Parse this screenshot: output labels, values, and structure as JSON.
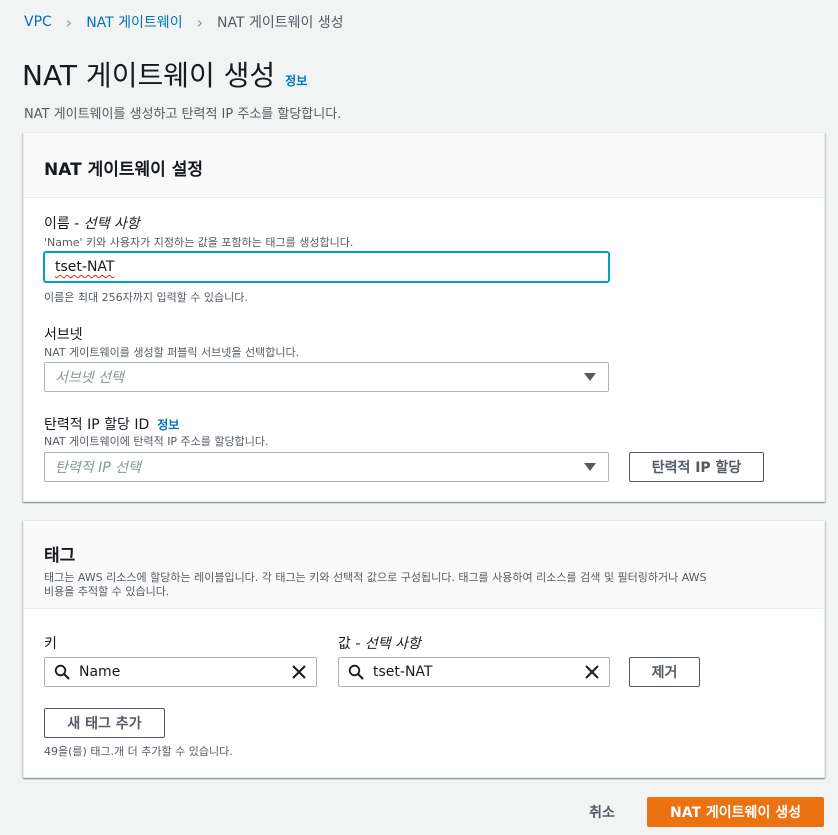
{
  "breadcrumb": {
    "items": [
      "VPC",
      "NAT 게이트웨이"
    ],
    "current": "NAT 게이트웨이 생성"
  },
  "page": {
    "title": "NAT 게이트웨이 생성",
    "info": "정보",
    "description": "NAT 게이트웨이를 생성하고 탄력적 IP 주소를 할당합니다."
  },
  "settings": {
    "title": "NAT 게이트웨이 설정",
    "name": {
      "label": "이름 - ",
      "label_optional": "선택 사항",
      "description": "'Name' 키와 사용자가 지정하는 값을 포함하는 태그를 생성합니다.",
      "value": "tset-NAT",
      "hint": "이름은 최대 256자까지 입력할 수 있습니다."
    },
    "subnet": {
      "label": "서브넷",
      "description": "NAT 게이트웨이를 생성할 퍼블릭 서브넷을 선택합니다.",
      "placeholder": "서브넷 선택"
    },
    "eip": {
      "label": "탄력적 IP 할당 ID",
      "info": "정보",
      "description": "NAT 게이트웨이에 탄력적 IP 주소를 할당합니다.",
      "placeholder": "탄력적 IP 선택",
      "allocate_button": "탄력적 IP 할당"
    }
  },
  "tags": {
    "title": "태그",
    "description_line1": "태그는 AWS 리소스에 할당하는 레이블입니다. 각 태그는 키와 선택적 값으로 구성됩니다. 태그를 사용하여 리소스를 검색 및 필터링하거나 AWS",
    "description_line2": "비용을 추적할 수 있습니다.",
    "key_label": "키",
    "value_label": "값 - ",
    "value_label_optional": "선택 사항",
    "rows": [
      {
        "key": "Name",
        "value": "tset-NAT"
      }
    ],
    "remove_button": "제거",
    "add_button": "새 태그 추가",
    "remaining": "49을(를) 태그.개 더 추가할 수 있습니다."
  },
  "footer": {
    "cancel": "취소",
    "create": "NAT 게이트웨이 생성"
  },
  "colors": {
    "primary": "#ec7211",
    "link": "#0073bb",
    "focus": "#00a1c9"
  }
}
